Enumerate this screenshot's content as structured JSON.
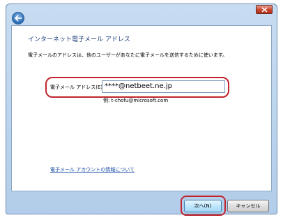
{
  "wizard": {
    "page_title": "インターネット電子メール アドレス",
    "description": "電子メールのアドレスは、他のユーザーがあなたに電子メールを送信するために使います。",
    "email_label": "電子メール アドレス(E):",
    "email_value": "****@netbeet.ne.jp",
    "example": "例: t-chofu@microsoft.com",
    "info_link": "電子メール アカウントの情報について"
  },
  "footer": {
    "next_label": "次へ(N)",
    "cancel_label": "キャンセル"
  },
  "colors": {
    "highlight": "#c0242c",
    "title_text": "#1c3e7a",
    "link": "#1a4fa8",
    "frame": "#b2cde9"
  },
  "icons": {
    "close": "close-icon",
    "back": "back-arrow-icon"
  }
}
